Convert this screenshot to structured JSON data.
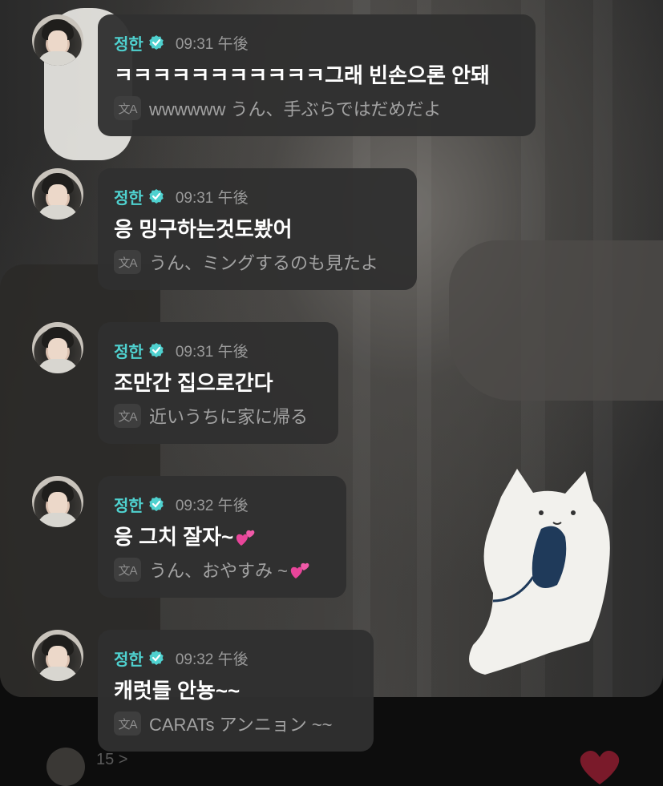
{
  "messages": [
    {
      "name": "정한",
      "time": "09:31 午後",
      "text": "ㅋㅋㅋㅋㅋㅋㅋㅋㅋㅋㅋ그래 빈손으론 안돼",
      "translation": "wwwwww うん、手ぶらではだめだよ",
      "heart": false
    },
    {
      "name": "정한",
      "time": "09:31 午後",
      "text": "응 밍구하는것도봤어",
      "translation": "うん、ミングするのも見たよ",
      "heart": false
    },
    {
      "name": "정한",
      "time": "09:31 午後",
      "text": "조만간 집으로간다",
      "translation": "近いうちに家に帰る",
      "heart": false
    },
    {
      "name": "정한",
      "time": "09:32 午後",
      "text": "응 그치 잘자~",
      "translation": "うん、おやすみ ~",
      "heart": true
    },
    {
      "name": "정한",
      "time": "09:32 午後",
      "text": "캐럿들 안뇽~~",
      "translation": "CARATs アンニョン ~~",
      "heart": false
    }
  ],
  "translate_icon_label": "文A",
  "footer": {
    "count": "15 >"
  },
  "colors": {
    "name": "#4fd1cf",
    "bubble": "#303030",
    "heart": "#e8459a"
  },
  "icons": {
    "verified": "verified-badge-icon",
    "translate": "translate-icon",
    "heart": "heart-icon"
  }
}
